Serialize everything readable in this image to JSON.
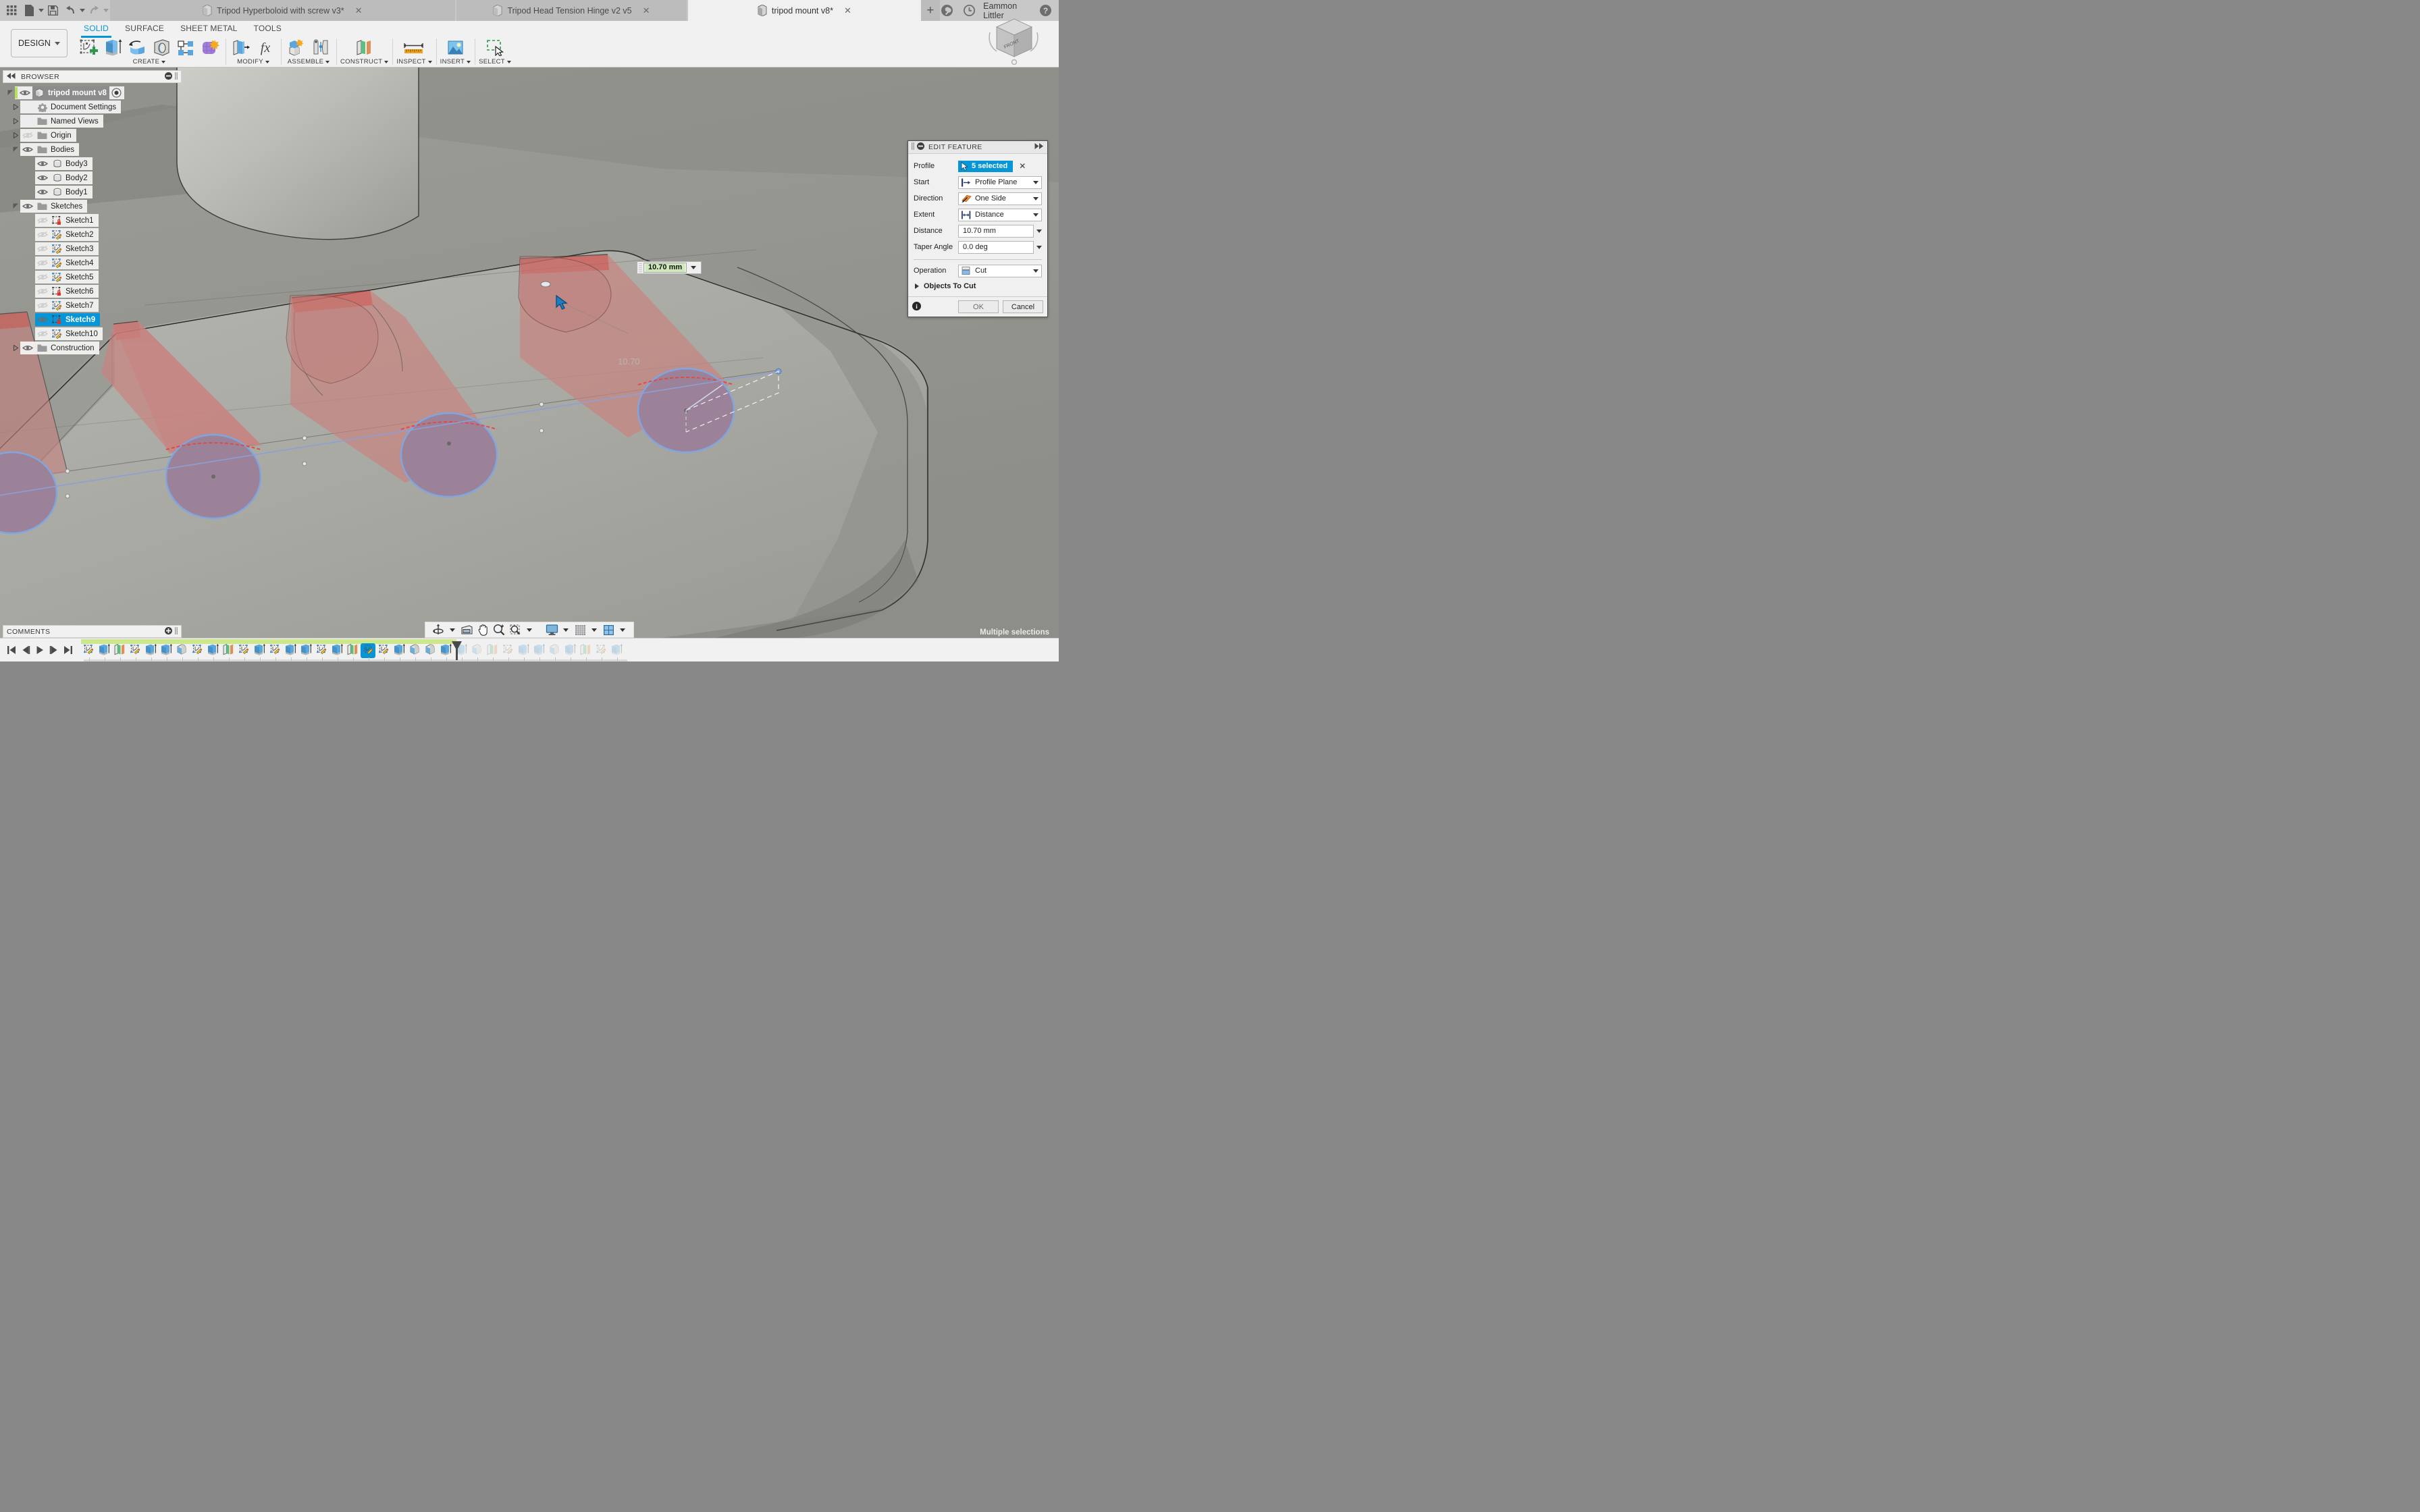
{
  "titlebar": {
    "grid_icon": "apps-grid-icon",
    "file_label": "file-icon",
    "save_label": "save-icon",
    "undo_label": "undo-icon",
    "redo_label": "redo-icon",
    "tabs": [
      {
        "title": "Tripod Hyperboloid with screw v3*",
        "active": false,
        "close": "✕"
      },
      {
        "title": "Tripod Head Tension Hinge v2 v5",
        "active": false,
        "close": "✕"
      },
      {
        "title": "tripod mount v8*",
        "active": true,
        "close": "✕"
      }
    ],
    "new_tab": "+",
    "username": "Eammon Littler",
    "job_icon": "wrench-icon",
    "history_icon": "clock-icon",
    "help_icon": "help-icon"
  },
  "ribbon": {
    "design_label": "DESIGN",
    "tabs": [
      {
        "label": "SOLID",
        "active": true
      },
      {
        "label": "SURFACE",
        "active": false
      },
      {
        "label": "SHEET METAL",
        "active": false
      },
      {
        "label": "TOOLS",
        "active": false
      }
    ],
    "panels": [
      {
        "label": "CREATE",
        "icons": [
          "create-sketch-icon",
          "extrude-icon",
          "revolve-icon",
          "sweep-icon",
          "pattern-icon",
          "form-icon"
        ]
      },
      {
        "label": "MODIFY",
        "icons": [
          "press-pull-icon",
          "change-parameters-icon"
        ]
      },
      {
        "label": "ASSEMBLE",
        "icons": [
          "new-component-icon",
          "joint-icon"
        ]
      },
      {
        "label": "CONSTRUCT",
        "icons": [
          "offset-plane-icon"
        ]
      },
      {
        "label": "INSPECT",
        "icons": [
          "measure-icon"
        ]
      },
      {
        "label": "INSERT",
        "icons": [
          "insert-image-icon"
        ]
      },
      {
        "label": "SELECT",
        "icons": [
          "select-window-icon"
        ]
      }
    ]
  },
  "browser": {
    "title": "BROWSER",
    "collapse_icon": "collapse-left-icon",
    "minimize_icon": "minimize-icon",
    "grip_icon": "grip-icon",
    "tree": [
      {
        "label": "tripod mount v8",
        "depth": 0,
        "arrow": "down",
        "eye": "visible",
        "icon": "component-icon",
        "type": "root",
        "selected": false,
        "radio": true
      },
      {
        "label": "Document Settings",
        "depth": 1,
        "arrow": "right",
        "eye": "none",
        "icon": "gear-icon",
        "type": "node",
        "selected": false
      },
      {
        "label": "Named Views",
        "depth": 1,
        "arrow": "right",
        "eye": "none",
        "icon": "folder-icon",
        "type": "node",
        "selected": false
      },
      {
        "label": "Origin",
        "depth": 1,
        "arrow": "right",
        "eye": "hidden",
        "icon": "folder-icon",
        "type": "node",
        "selected": false
      },
      {
        "label": "Bodies",
        "depth": 1,
        "arrow": "down",
        "eye": "visible",
        "icon": "folder-icon",
        "type": "node",
        "selected": false
      },
      {
        "label": "Body3",
        "depth": 2,
        "arrow": "none",
        "eye": "visible",
        "icon": "body-icon",
        "type": "leaf",
        "selected": false
      },
      {
        "label": "Body2",
        "depth": 2,
        "arrow": "none",
        "eye": "visible",
        "icon": "body-icon",
        "type": "leaf",
        "selected": false
      },
      {
        "label": "Body1",
        "depth": 2,
        "arrow": "none",
        "eye": "visible",
        "icon": "body-icon",
        "type": "leaf",
        "selected": false
      },
      {
        "label": "Sketches",
        "depth": 1,
        "arrow": "down",
        "eye": "visible",
        "icon": "folder-icon",
        "type": "node",
        "selected": false
      },
      {
        "label": "Sketch1",
        "depth": 2,
        "arrow": "none",
        "eye": "hidden",
        "icon": "sketch-locked-icon",
        "type": "leaf",
        "selected": false
      },
      {
        "label": "Sketch2",
        "depth": 2,
        "arrow": "none",
        "eye": "hidden",
        "icon": "sketch-icon",
        "type": "leaf",
        "selected": false
      },
      {
        "label": "Sketch3",
        "depth": 2,
        "arrow": "none",
        "eye": "hidden",
        "icon": "sketch-icon",
        "type": "leaf",
        "selected": false
      },
      {
        "label": "Sketch4",
        "depth": 2,
        "arrow": "none",
        "eye": "hidden",
        "icon": "sketch-icon",
        "type": "leaf",
        "selected": false
      },
      {
        "label": "Sketch5",
        "depth": 2,
        "arrow": "none",
        "eye": "hidden",
        "icon": "sketch-icon",
        "type": "leaf",
        "selected": false
      },
      {
        "label": "Sketch6",
        "depth": 2,
        "arrow": "none",
        "eye": "hidden",
        "icon": "sketch-locked-icon",
        "type": "leaf",
        "selected": false
      },
      {
        "label": "Sketch7",
        "depth": 2,
        "arrow": "none",
        "eye": "hidden",
        "icon": "sketch-icon",
        "type": "leaf",
        "selected": false
      },
      {
        "label": "Sketch9",
        "depth": 2,
        "arrow": "none",
        "eye": "visible",
        "icon": "sketch-locked-icon",
        "type": "leaf",
        "selected": true
      },
      {
        "label": "Sketch10",
        "depth": 2,
        "arrow": "none",
        "eye": "hidden",
        "icon": "sketch-icon",
        "type": "leaf",
        "selected": false
      },
      {
        "label": "Construction",
        "depth": 1,
        "arrow": "right",
        "eye": "visible",
        "icon": "folder-icon",
        "type": "node",
        "selected": false
      }
    ]
  },
  "dialog": {
    "title": "EDIT FEATURE",
    "menu_icon": "dialog-menu-icon",
    "expand_icon": "expand-right-icon",
    "fields": [
      {
        "label": "Profile",
        "type": "select",
        "value": "5 selected",
        "icon": "cursor-select-icon",
        "clear": "✕"
      },
      {
        "label": "Start",
        "type": "dropdown",
        "value": "Profile Plane",
        "icon": "profile-plane-icon"
      },
      {
        "label": "Direction",
        "type": "dropdown",
        "value": "One Side",
        "icon": "one-side-icon"
      },
      {
        "label": "Extent",
        "type": "dropdown",
        "value": "Distance",
        "icon": "distance-icon"
      },
      {
        "label": "Distance",
        "type": "number",
        "value": "10.70 mm"
      },
      {
        "label": "Taper Angle",
        "type": "number",
        "value": "0.0 deg"
      }
    ],
    "operation": {
      "label": "Operation",
      "value": "Cut",
      "icon": "cut-operation-icon"
    },
    "objects_to_cut": "Objects To Cut",
    "info_icon": "info-icon",
    "ok_label": "OK",
    "cancel_label": "Cancel"
  },
  "viewport": {
    "inline_dimension": "10.70 mm",
    "ghost_dimension": "10.70",
    "cursor_icon": "arrow-cursor-icon",
    "viewcube_front_label": "FRONT"
  },
  "comments": {
    "title": "COMMENTS",
    "add_icon": "add-comment-icon",
    "grip_icon": "grip-icon"
  },
  "navbar": {
    "items": [
      {
        "name": "orbit-icon",
        "caret": true
      },
      {
        "name": "look-at-icon",
        "caret": false
      },
      {
        "name": "pan-icon",
        "caret": false
      },
      {
        "name": "zoom-icon",
        "caret": false
      },
      {
        "name": "zoom-window-icon",
        "caret": true
      },
      {
        "name": "display-settings-icon",
        "caret": true
      },
      {
        "name": "grid-snaps-icon",
        "caret": true
      },
      {
        "name": "viewports-icon",
        "caret": true
      }
    ]
  },
  "status": {
    "text": "Multiple selections"
  },
  "timeline": {
    "playback": [
      "jump-start-icon",
      "step-back-icon",
      "play-icon",
      "step-forward-icon",
      "jump-end-icon"
    ],
    "features": [
      {
        "icon": "sketch-icon",
        "sel": false
      },
      {
        "icon": "extrude-icon",
        "sel": false
      },
      {
        "icon": "plane-icon",
        "sel": false
      },
      {
        "icon": "sketch-icon",
        "sel": false
      },
      {
        "icon": "extrude-icon",
        "sel": false
      },
      {
        "icon": "extrude-icon",
        "sel": false
      },
      {
        "icon": "fillet-icon",
        "sel": false
      },
      {
        "icon": "sketch-icon",
        "sel": false
      },
      {
        "icon": "extrude-icon",
        "sel": false
      },
      {
        "icon": "plane-icon",
        "sel": false
      },
      {
        "icon": "sketch-icon",
        "sel": false
      },
      {
        "icon": "extrude-icon",
        "sel": false
      },
      {
        "icon": "sketch-icon",
        "sel": false
      },
      {
        "icon": "extrude-icon",
        "sel": false
      },
      {
        "icon": "extrude-icon",
        "sel": false
      },
      {
        "icon": "sketch-icon",
        "sel": false
      },
      {
        "icon": "extrude-icon",
        "sel": false
      },
      {
        "icon": "plane-icon",
        "sel": false
      },
      {
        "icon": "sketch-icon",
        "sel": true
      },
      {
        "icon": "sketch-icon",
        "sel": false
      },
      {
        "icon": "extrude-icon",
        "sel": false
      },
      {
        "icon": "fillet-icon",
        "sel": false
      },
      {
        "icon": "fillet-icon",
        "sel": false
      },
      {
        "icon": "extrude-icon",
        "sel": false
      },
      {
        "icon": "extrude-ghost-icon",
        "sel": false
      },
      {
        "icon": "fillet-ghost-icon",
        "sel": false
      },
      {
        "icon": "plane-ghost-icon",
        "sel": false
      },
      {
        "icon": "sketch-ghost-icon",
        "sel": false
      },
      {
        "icon": "extrude-ghost-icon",
        "sel": false
      },
      {
        "icon": "extrude-ghost-icon",
        "sel": false
      },
      {
        "icon": "fillet-ghost-icon",
        "sel": false
      },
      {
        "icon": "extrude-ghost-icon",
        "sel": false
      },
      {
        "icon": "plane-ghost-icon",
        "sel": false
      },
      {
        "icon": "sketch-ghost-icon",
        "sel": false
      },
      {
        "icon": "extrude-ghost-icon",
        "sel": false
      }
    ],
    "marker_after_index": 23
  },
  "colors": {
    "accent": "#0696d7",
    "cut_red": "#c85450",
    "profile_fill": "#9a8099",
    "timeline_green": "#cde88c",
    "viewport_bg": "#9a9a94"
  }
}
